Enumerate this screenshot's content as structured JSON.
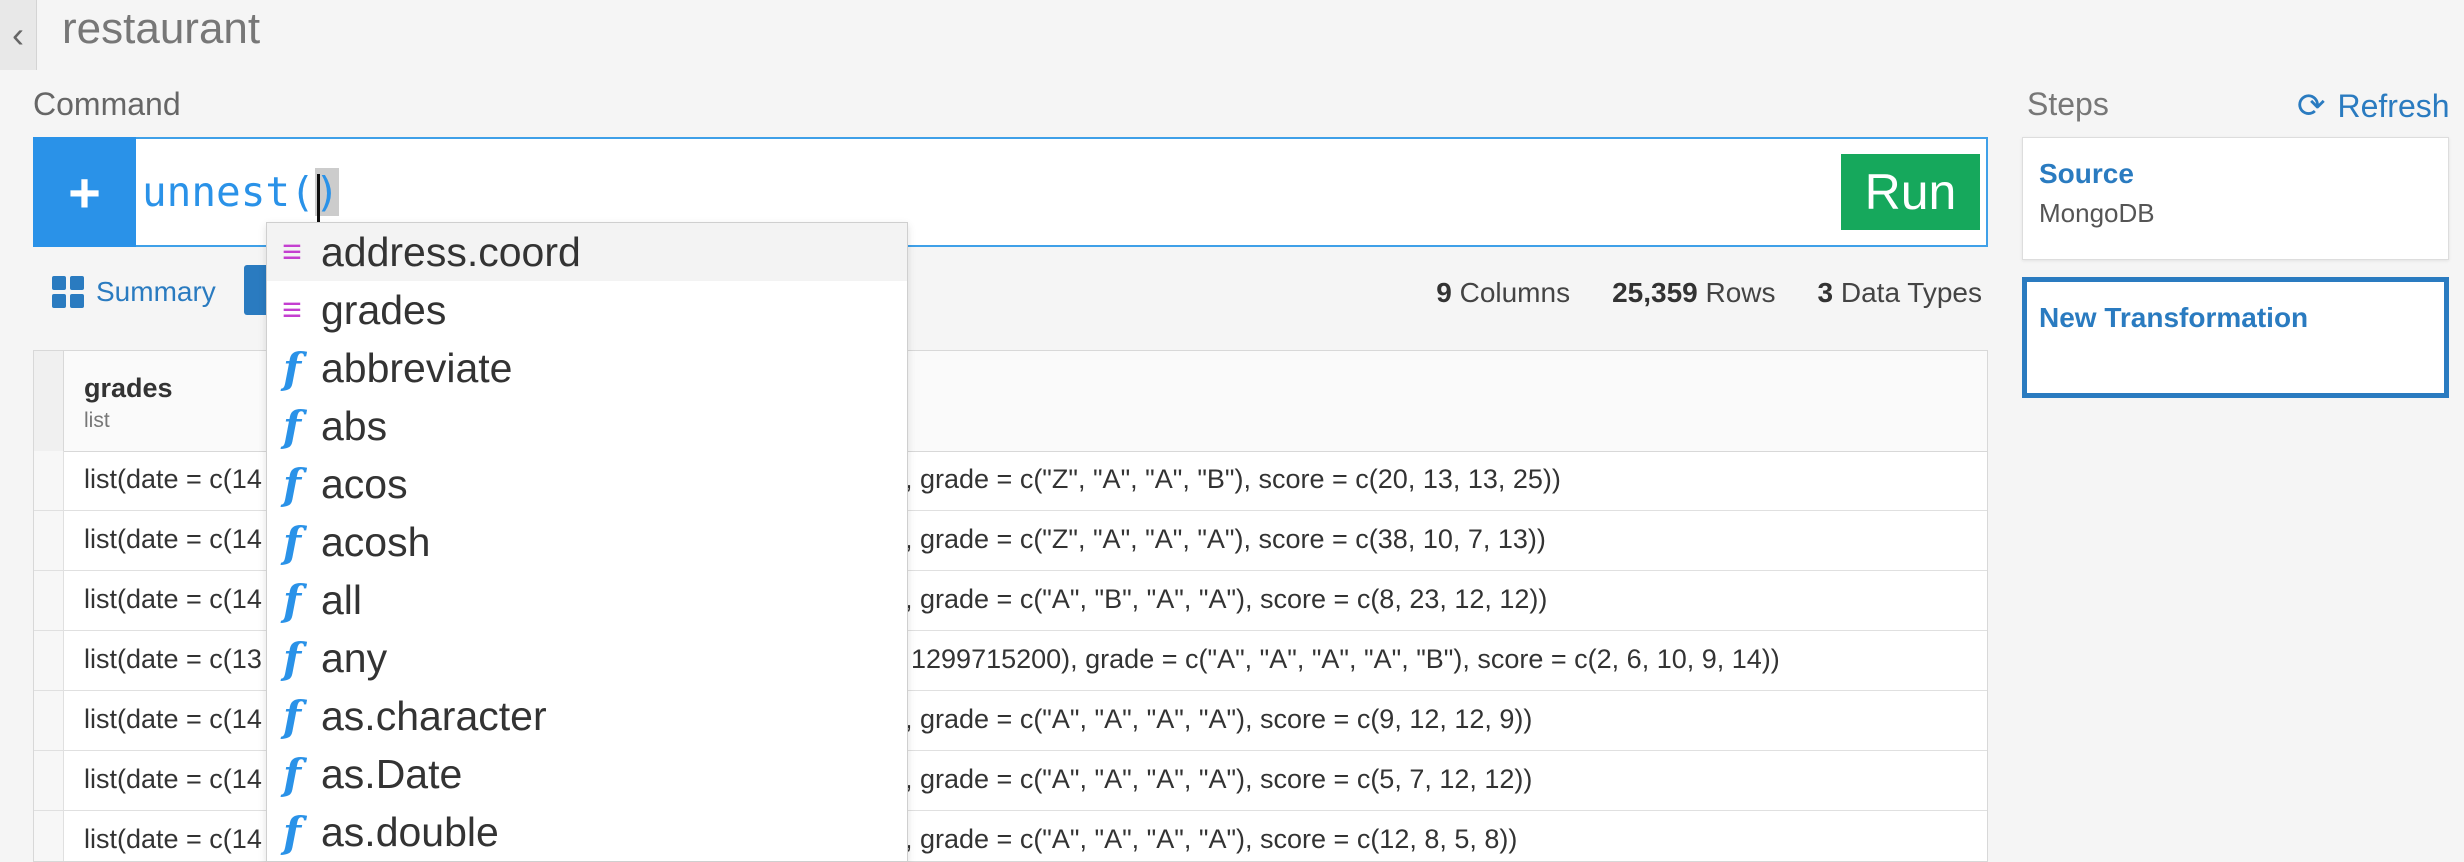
{
  "header": {
    "back_icon": "chevron-left-icon",
    "back_glyph": "‹",
    "title": "restaurant"
  },
  "command": {
    "label": "Command",
    "add_icon": "plus-icon",
    "add_glyph": "+",
    "input_text": "unnest(",
    "input_close": ")",
    "run_label": "Run"
  },
  "toolbar": {
    "summary_label": "Summary",
    "stats": {
      "columns_count": "9",
      "columns_label": "Columns",
      "rows_count": "25,359",
      "rows_label": "Rows",
      "types_count": "3",
      "types_label": "Data Types"
    }
  },
  "table": {
    "column": {
      "name": "grades",
      "type": "list"
    },
    "rows": [
      {
        "left": "list(date = c(14",
        "right": "), grade = c(\"Z\", \"A\", \"A\", \"B\"), score = c(20, 13, 13, 25))"
      },
      {
        "left": "list(date = c(14",
        "right": "), grade = c(\"Z\", \"A\", \"A\", \"A\"), score = c(38, 10, 7, 13))"
      },
      {
        "left": "list(date = c(14",
        "right": "), grade = c(\"A\", \"B\", \"A\", \"A\"), score = c(8, 23, 12, 12))"
      },
      {
        "left": "list(date = c(13",
        "right": ", 1299715200), grade = c(\"A\", \"A\", \"A\", \"A\", \"B\"), score = c(2, 6, 10, 9, 14))"
      },
      {
        "left": "list(date = c(14",
        "right": "), grade = c(\"A\", \"A\", \"A\", \"A\"), score = c(9, 12, 12, 9))"
      },
      {
        "left": "list(date = c(14",
        "right": "), grade = c(\"A\", \"A\", \"A\", \"A\"), score = c(5, 7, 12, 12))"
      },
      {
        "left": "list(date = c(14",
        "right": "), grade = c(\"A\", \"A\", \"A\", \"A\"), score = c(12, 8, 5, 8))"
      }
    ]
  },
  "autocomplete": {
    "items": [
      {
        "kind": "column",
        "icon": "column-icon",
        "glyph": "≡",
        "label": "address.coord"
      },
      {
        "kind": "column",
        "icon": "column-icon",
        "glyph": "≡",
        "label": "grades"
      },
      {
        "kind": "function",
        "icon": "function-icon",
        "glyph": "f",
        "label": "abbreviate"
      },
      {
        "kind": "function",
        "icon": "function-icon",
        "glyph": "f",
        "label": "abs"
      },
      {
        "kind": "function",
        "icon": "function-icon",
        "glyph": "f",
        "label": "acos"
      },
      {
        "kind": "function",
        "icon": "function-icon",
        "glyph": "f",
        "label": "acosh"
      },
      {
        "kind": "function",
        "icon": "function-icon",
        "glyph": "f",
        "label": "all"
      },
      {
        "kind": "function",
        "icon": "function-icon",
        "glyph": "f",
        "label": "any"
      },
      {
        "kind": "function",
        "icon": "function-icon",
        "glyph": "f",
        "label": "as.character"
      },
      {
        "kind": "function",
        "icon": "function-icon",
        "glyph": "f",
        "label": "as.Date"
      },
      {
        "kind": "function",
        "icon": "function-icon",
        "glyph": "f",
        "label": "as.double"
      }
    ]
  },
  "steps": {
    "label": "Steps",
    "refresh_label": "Refresh",
    "refresh_icon": "refresh-icon",
    "refresh_glyph": "⟳",
    "items": [
      {
        "title": "Source",
        "subtitle": "MongoDB"
      },
      {
        "title": "New Transformation",
        "subtitle": ""
      }
    ]
  },
  "colors": {
    "accent": "#2a92e8",
    "link": "#2a7bc0",
    "run": "#16a85c",
    "column_icon": "#c43fd0"
  }
}
